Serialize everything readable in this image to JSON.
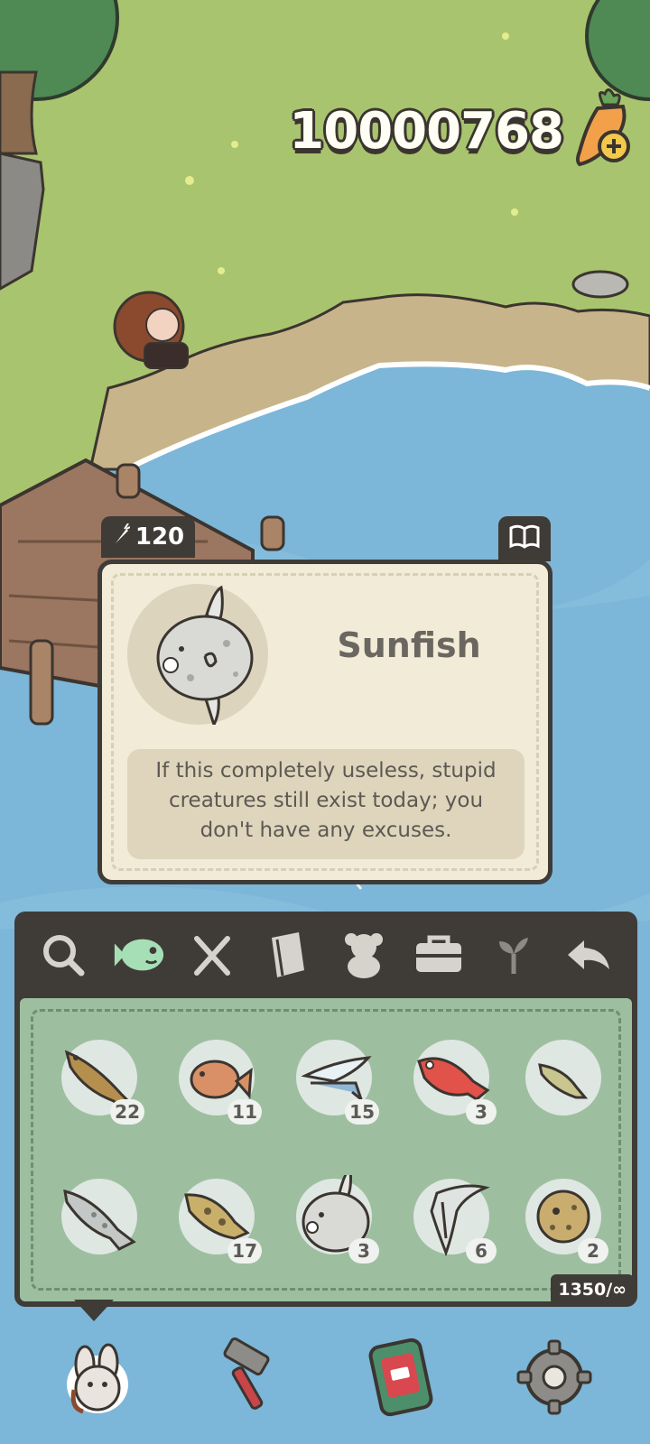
{
  "hud": {
    "currency_value": "10000768",
    "currency_icon": "carrot-plus-icon"
  },
  "fish_card": {
    "price": "120",
    "price_icon": "carrot-icon",
    "book_icon": "open-book-icon",
    "name": "Sunfish",
    "description": "If this completely useless, stupid creatures still exist today; you don't have any excuses."
  },
  "toolbar": {
    "tabs": [
      {
        "icon": "magnifier-icon",
        "active": false
      },
      {
        "icon": "fish-icon",
        "active": true
      },
      {
        "icon": "fork-knife-icon",
        "active": false
      },
      {
        "icon": "book-icon",
        "active": false
      },
      {
        "icon": "teddy-bear-icon",
        "active": false
      },
      {
        "icon": "toolbox-icon",
        "active": false
      },
      {
        "icon": "sprout-icon",
        "active": false
      },
      {
        "icon": "back-arrow-icon",
        "active": false
      }
    ]
  },
  "inventory": {
    "items": [
      {
        "name": "trout",
        "count": "22"
      },
      {
        "name": "goldfish",
        "count": "11"
      },
      {
        "name": "flying fish",
        "count": "15"
      },
      {
        "name": "red snapper",
        "count": "3"
      },
      {
        "name": "minnow",
        "count": ""
      },
      {
        "name": "catfish",
        "count": ""
      },
      {
        "name": "carp",
        "count": "17"
      },
      {
        "name": "sunfish",
        "count": "3"
      },
      {
        "name": "angelfish",
        "count": "6"
      },
      {
        "name": "pufferfish",
        "count": "2"
      }
    ],
    "capacity": "1350/∞"
  },
  "bottom_bar": [
    {
      "icon": "bunny-backpack-icon"
    },
    {
      "icon": "hammer-icon"
    },
    {
      "icon": "phone-icon"
    },
    {
      "icon": "settings-gear-icon"
    }
  ],
  "colors": {
    "grass": "#a9c46e",
    "water": "#7cb6d8",
    "panel_dark": "#3f3b37",
    "card_bg": "#f1ebd7",
    "grid_bg": "#9dbf9f",
    "active_tab": "#a6dfb6"
  }
}
